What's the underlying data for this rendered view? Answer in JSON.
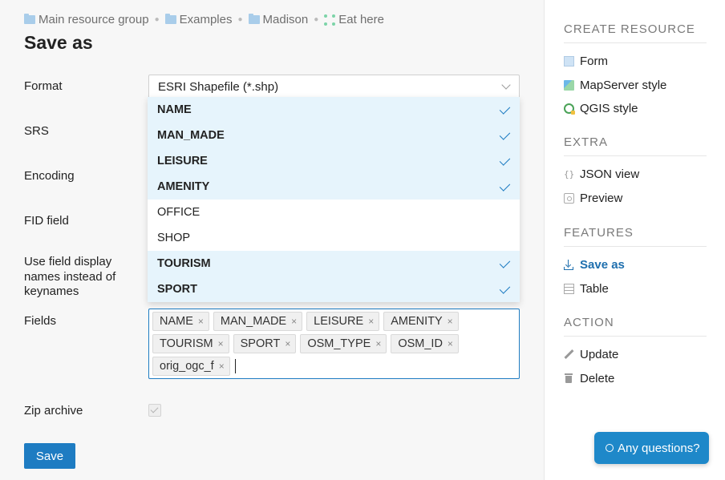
{
  "breadcrumb": [
    {
      "label": "Main resource group",
      "icon": "folder-icon"
    },
    {
      "label": "Examples",
      "icon": "folder-icon"
    },
    {
      "label": "Madison",
      "icon": "folder-icon"
    },
    {
      "label": "Eat here",
      "icon": "vector-layer-icon"
    }
  ],
  "page_title": "Save as",
  "form": {
    "format_label": "Format",
    "format_value": "ESRI Shapefile (*.shp)",
    "srs_label": "SRS",
    "encoding_label": "Encoding",
    "fid_label": "FID field",
    "display_names_label": "Use field display names instead of keynames",
    "fields_label": "Fields",
    "zip_label": "Zip archive",
    "zip_checked": true,
    "save_label": "Save"
  },
  "dropdown": {
    "options": [
      {
        "label": "NAME",
        "selected": true
      },
      {
        "label": "MAN_MADE",
        "selected": true
      },
      {
        "label": "LEISURE",
        "selected": true
      },
      {
        "label": "AMENITY",
        "selected": true
      },
      {
        "label": "OFFICE",
        "selected": false
      },
      {
        "label": "SHOP",
        "selected": false
      },
      {
        "label": "TOURISM",
        "selected": true
      },
      {
        "label": "SPORT",
        "selected": true
      }
    ]
  },
  "fields": {
    "tags": [
      "NAME",
      "MAN_MADE",
      "LEISURE",
      "AMENITY",
      "TOURISM",
      "SPORT",
      "OSM_TYPE",
      "OSM_ID",
      "orig_ogc_f"
    ],
    "remove_glyph": "×"
  },
  "sidebar": {
    "sections": [
      {
        "heading": "CREATE RESOURCE",
        "items": [
          {
            "label": "Form",
            "icon": "form-icon"
          },
          {
            "label": "MapServer style",
            "icon": "mapserver-style-icon"
          },
          {
            "label": "QGIS style",
            "icon": "qgis-style-icon"
          }
        ]
      },
      {
        "heading": "EXTRA",
        "items": [
          {
            "label": "JSON view",
            "icon": "json-icon"
          },
          {
            "label": "Preview",
            "icon": "preview-icon"
          }
        ]
      },
      {
        "heading": "FEATURES",
        "items": [
          {
            "label": "Save as",
            "icon": "download-icon",
            "active": true
          },
          {
            "label": "Table",
            "icon": "table-icon"
          }
        ]
      },
      {
        "heading": "ACTION",
        "items": [
          {
            "label": "Update",
            "icon": "pencil-icon"
          },
          {
            "label": "Delete",
            "icon": "trash-icon"
          }
        ]
      }
    ]
  },
  "chat": {
    "label": "Any questions?"
  },
  "colors": {
    "accent": "#1e7cc2",
    "selected_bg": "#e6f4fc",
    "chat": "#1e88c9"
  }
}
